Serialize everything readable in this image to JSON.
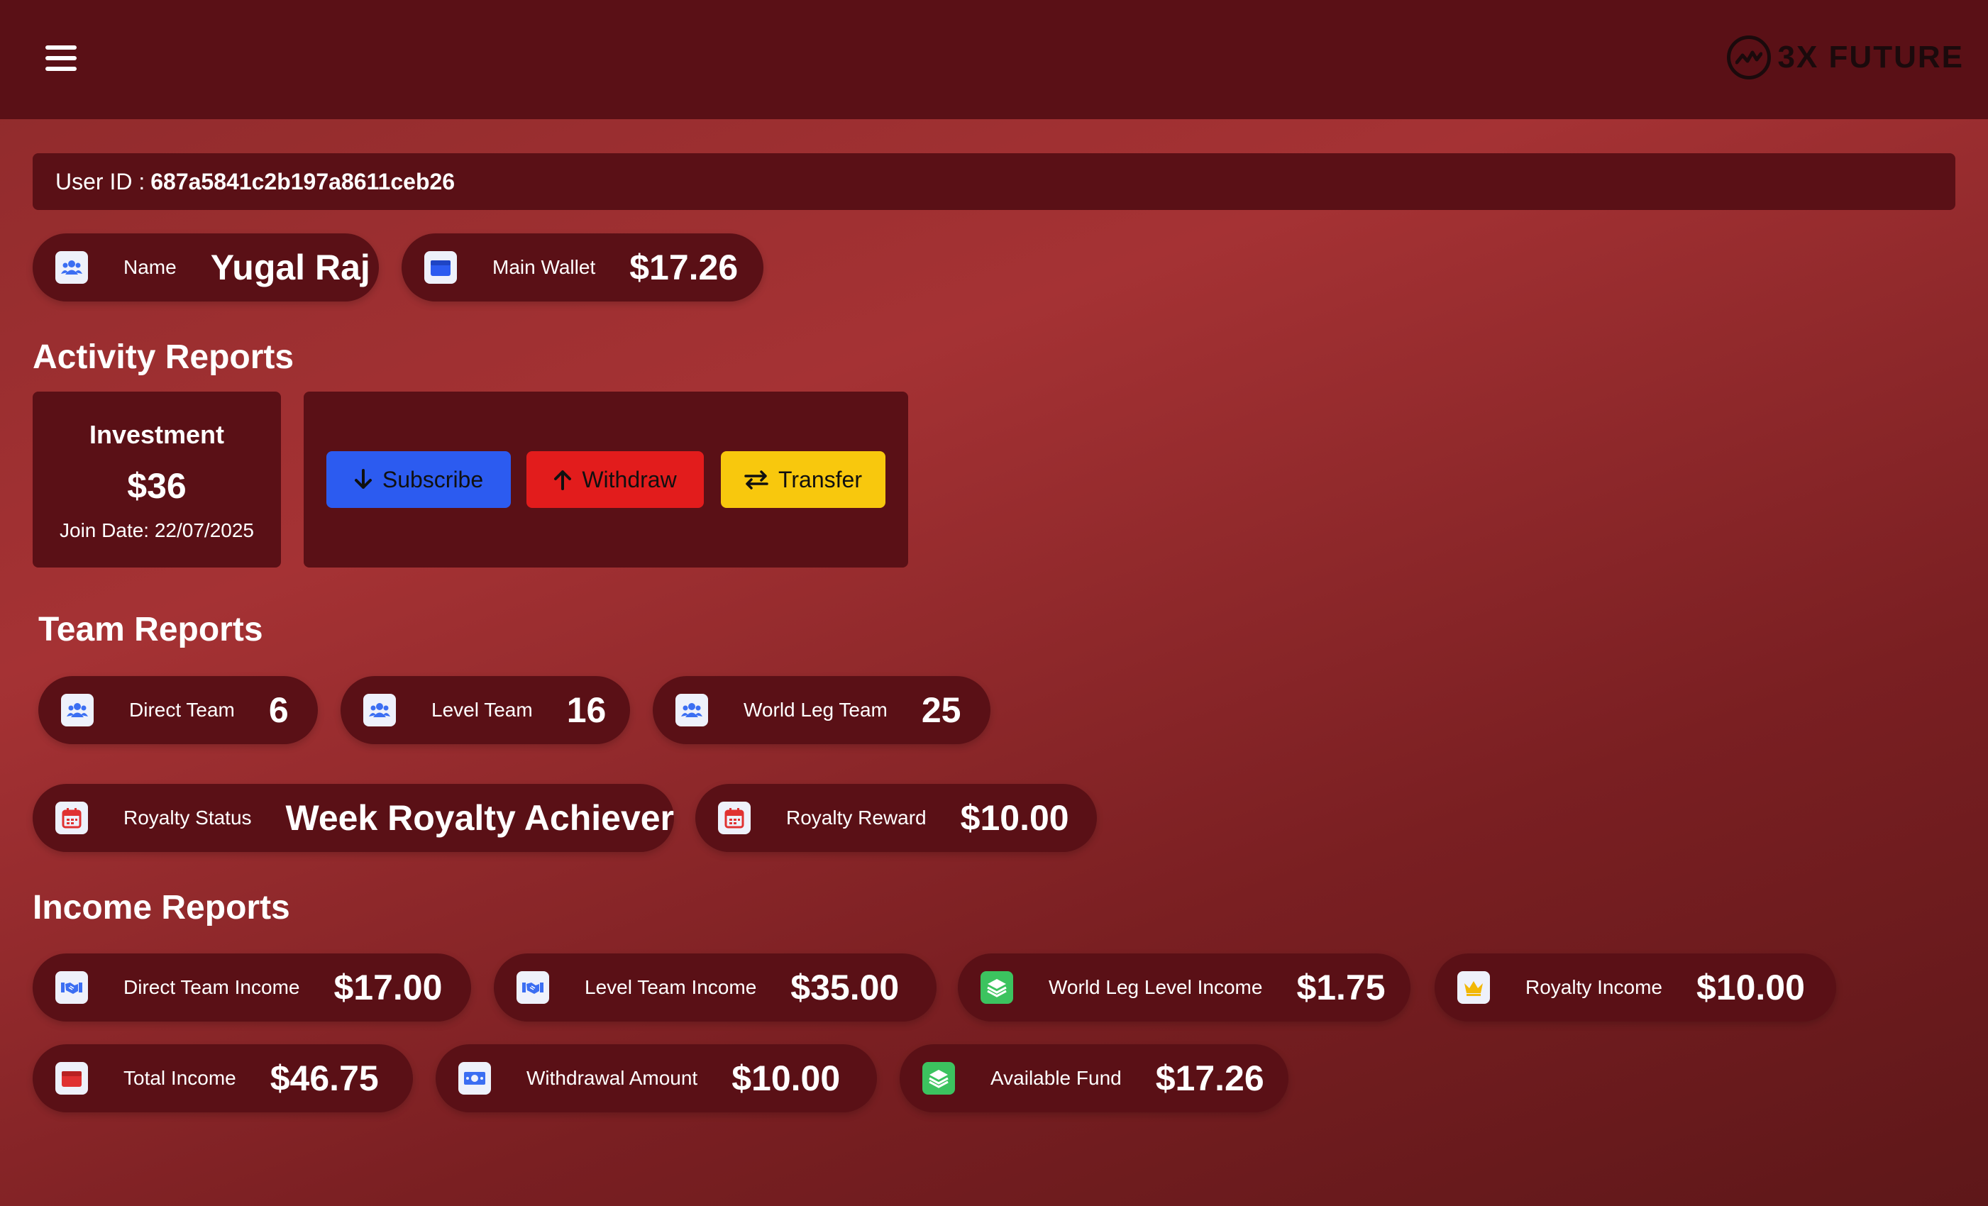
{
  "header": {
    "brand": "3X FUTURE"
  },
  "user": {
    "id_label": "User ID :",
    "id_value": "687a5841c2b197a8611ceb26",
    "name_label": "Name",
    "name_value": "Yugal Raj",
    "wallet_label": "Main Wallet",
    "wallet_value": "$17.26"
  },
  "activity": {
    "title": "Activity Reports",
    "investment_title": "Investment",
    "investment_value": "$36",
    "join_date": "Join Date: 22/07/2025",
    "subscribe_label": "Subscribe",
    "withdraw_label": "Withdraw",
    "transfer_label": "Transfer"
  },
  "team": {
    "title": "Team Reports",
    "direct_label": "Direct Team",
    "direct_value": "6",
    "level_label": "Level Team",
    "level_value": "16",
    "worldleg_label": "World Leg Team",
    "worldleg_value": "25",
    "royalty_status_label": "Royalty Status",
    "royalty_status_value": "Week Royalty Achiever",
    "royalty_reward_label": "Royalty Reward",
    "royalty_reward_value": "$10.00"
  },
  "income": {
    "title": "Income Reports",
    "direct_label": "Direct Team Income",
    "direct_value": "$17.00",
    "level_label": "Level Team Income",
    "level_value": "$35.00",
    "worldleg_label": "World Leg Level Income",
    "worldleg_value": "$1.75",
    "royalty_label": "Royalty Income",
    "royalty_value": "$10.00",
    "total_label": "Total Income",
    "total_value": "$46.75",
    "withdrawal_label": "Withdrawal Amount",
    "withdrawal_value": "$10.00",
    "available_label": "Available Fund",
    "available_value": "$17.26"
  },
  "colors": {
    "panel": "#5a1016",
    "subscribe": "#2c5bf0",
    "withdraw": "#e21c1c",
    "transfer": "#f8c80d"
  }
}
